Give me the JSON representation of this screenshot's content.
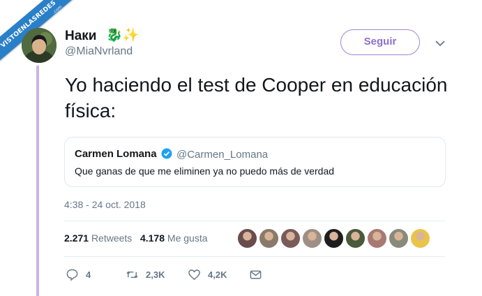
{
  "watermark": {
    "text": "VISTOENLASREDES",
    "sub": ".com"
  },
  "author": {
    "name": "Наки",
    "name_emoji": "🐉✨",
    "handle": "@MiaNvrland"
  },
  "follow_button": {
    "label": "Seguir"
  },
  "tweet": {
    "text": "Yo haciendo el test de Cooper en educación física:"
  },
  "quoted_tweet": {
    "name": "Carmen Lomana",
    "handle": "@Carmen_Lomana",
    "text": "Que ganas de que me eliminen ya no puedo más de verdad"
  },
  "timestamp": "4:38 - 24 oct. 2018",
  "stats": {
    "retweets_count": "2.271",
    "retweets_label": "Retweets",
    "likes_count": "4.178",
    "likes_label": "Me gusta"
  },
  "liker_avatars": [
    "#6a4c4c",
    "#8a7a6a",
    "#7b5a5a",
    "#9e8e84",
    "#1e1e1e",
    "#4a5a3a",
    "#a87a72",
    "#8a8a7a",
    "#e9c44a"
  ],
  "actions": {
    "reply_count": "4",
    "retweet_count": "2,3K",
    "like_count": "4,2K"
  },
  "colors": {
    "accent": "#8d6fd0",
    "thread_line": "#c9b5e8",
    "muted": "#657786",
    "watermark": "#2a80c8",
    "verified": "#1da1f2"
  }
}
